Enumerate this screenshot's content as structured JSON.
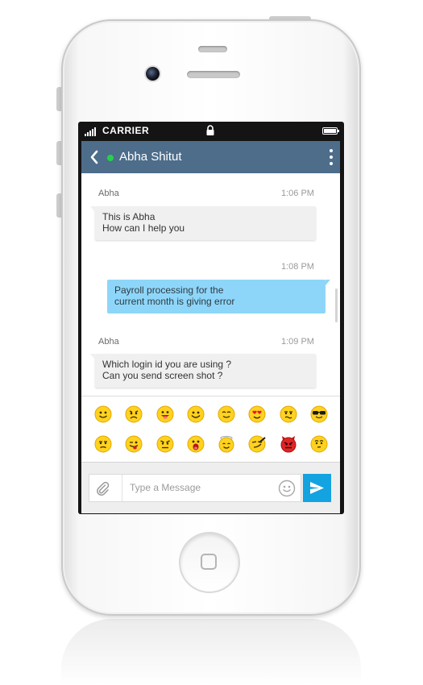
{
  "status_bar": {
    "carrier": "CARRIER"
  },
  "header": {
    "contact_name": "Abha Shitut",
    "online": true
  },
  "messages": [
    {
      "direction": "incoming",
      "sender": "Abha",
      "time": "1:06 PM",
      "lines": [
        "This is Abha",
        "How can I help you"
      ]
    },
    {
      "direction": "outgoing",
      "sender": "",
      "time": "1:08 PM",
      "lines": [
        "Payroll processing for the",
        "current month is giving error"
      ]
    },
    {
      "direction": "incoming",
      "sender": "Abha",
      "time": "1:09 PM",
      "lines": [
        "Which login id you are using ?",
        "Can you send screen shot ?"
      ]
    }
  ],
  "emoji_panel": {
    "rows": [
      [
        "smile",
        "sad",
        "tongue",
        "happy",
        "blush",
        "heart-eyes",
        "confused",
        "sunglasses"
      ],
      [
        "frown",
        "wink-tongue",
        "angry",
        "surprised",
        "angel",
        "smirk",
        "devil",
        "worried"
      ]
    ]
  },
  "input": {
    "placeholder": "Type a Message",
    "value": ""
  },
  "colors": {
    "header": "#4d6d8b",
    "outgoing_bubble": "#8ed6f9",
    "send_button": "#13a3e0",
    "online": "#25d14a"
  }
}
